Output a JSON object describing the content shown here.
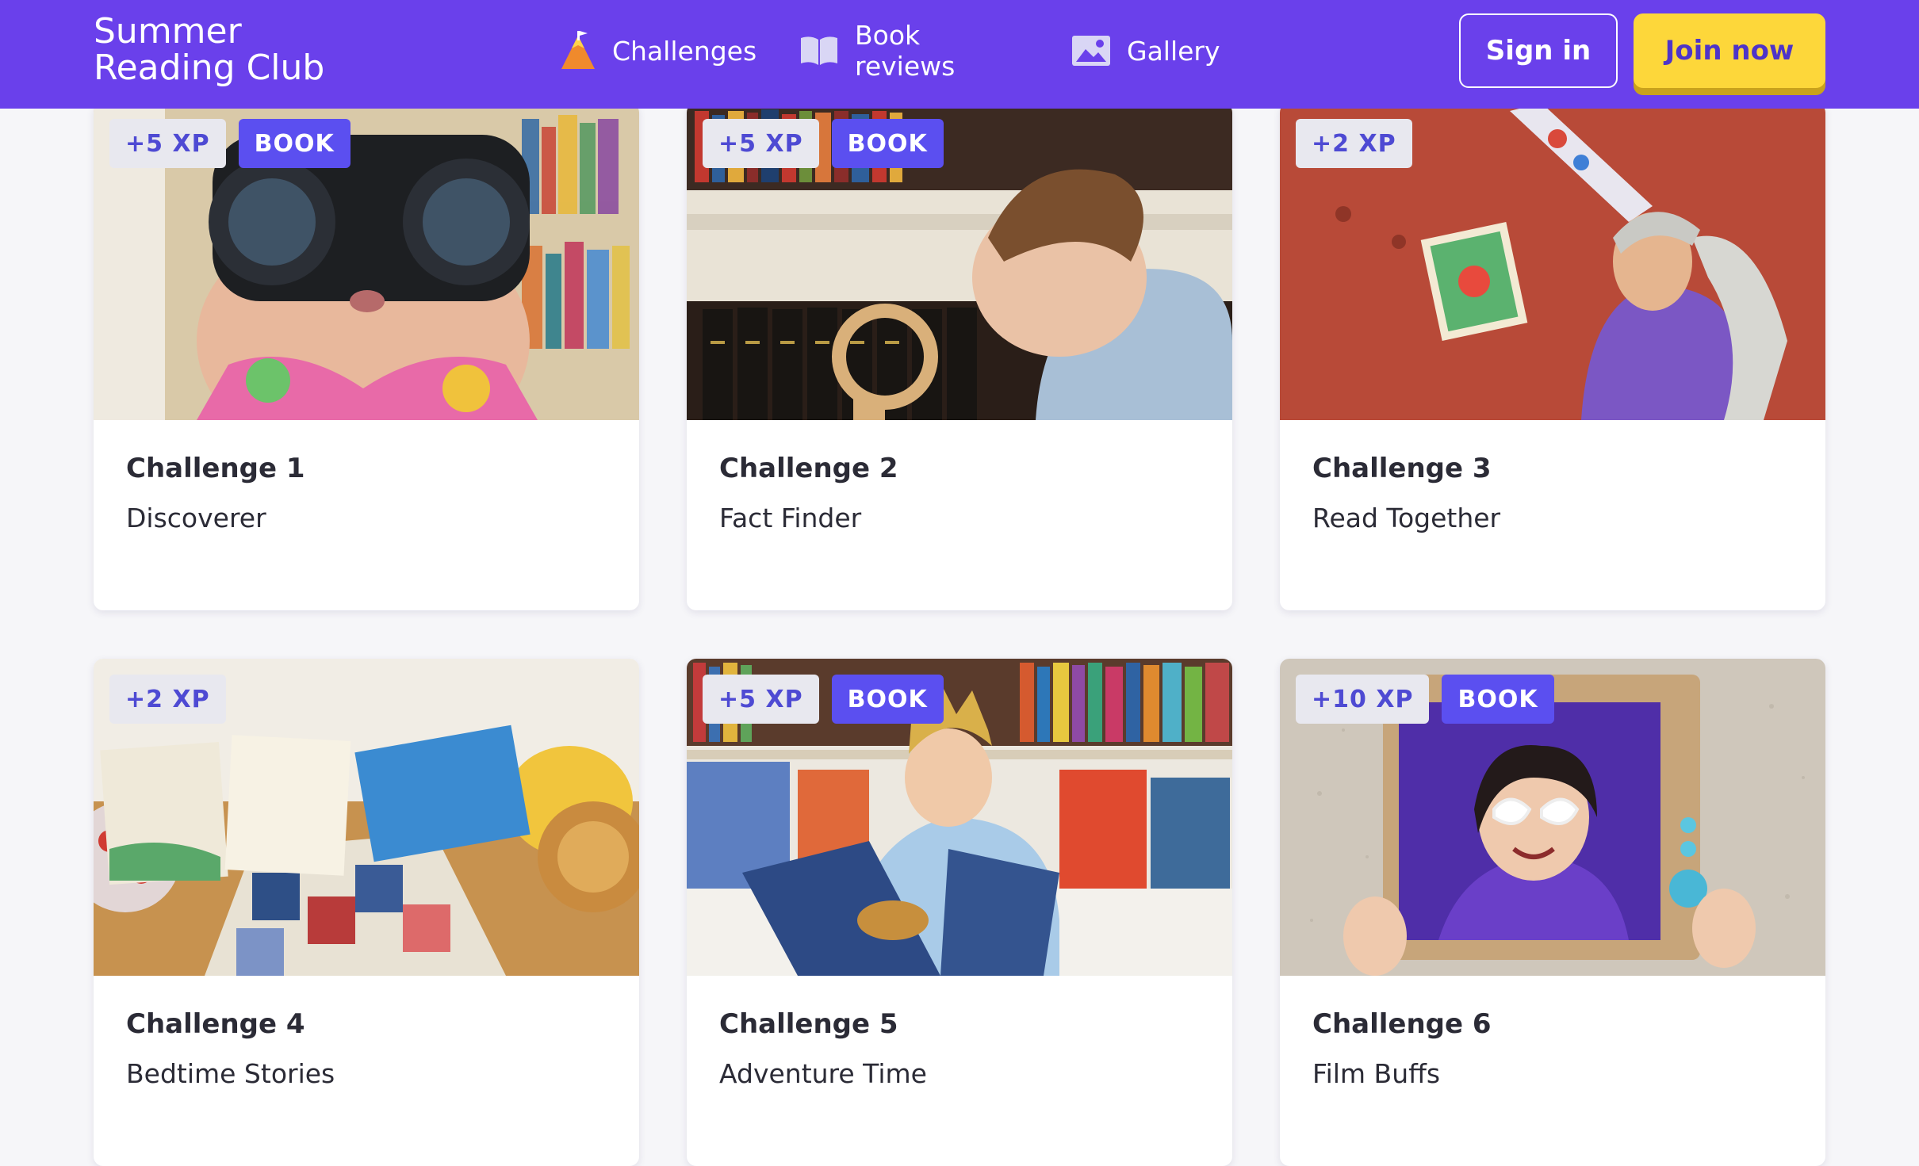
{
  "header": {
    "logo": {
      "line1": "Summer",
      "line2": "Reading Club"
    },
    "nav": [
      {
        "label": "Challenges",
        "icon": "mountain-icon"
      },
      {
        "label": "Book reviews",
        "icon": "open-book-icon"
      },
      {
        "label": "Gallery",
        "icon": "image-icon"
      }
    ],
    "sign_in": "Sign in",
    "join_now": "Join now"
  },
  "colors": {
    "header_bg": "#6a40eb",
    "join_bg": "#fdd73a",
    "xp_badge_bg": "#e8e8ef",
    "book_badge_bg": "#5b4ff0"
  },
  "challenges": [
    {
      "xp": "+5 XP",
      "book": "BOOK",
      "title": "Challenge 1",
      "name": "Discoverer",
      "image": "woman-with-binoculars"
    },
    {
      "xp": "+5 XP",
      "book": "BOOK",
      "title": "Challenge 2",
      "name": "Fact Finder",
      "image": "man-with-magnifying-glass"
    },
    {
      "xp": "+2 XP",
      "title": "Challenge 3",
      "name": "Read Together",
      "image": "woman-reading-with-megaphone"
    },
    {
      "xp": "+2 XP",
      "title": "Challenge 4",
      "name": "Bedtime Stories",
      "image": "children-reading-in-bed"
    },
    {
      "xp": "+5 XP",
      "book": "BOOK",
      "title": "Challenge 5",
      "name": "Adventure Time",
      "image": "man-reading-myths-book"
    },
    {
      "xp": "+10 XP",
      "book": "BOOK",
      "title": "Challenge 6",
      "name": "Film Buffs",
      "image": "woman-in-cardboard-tv"
    }
  ]
}
